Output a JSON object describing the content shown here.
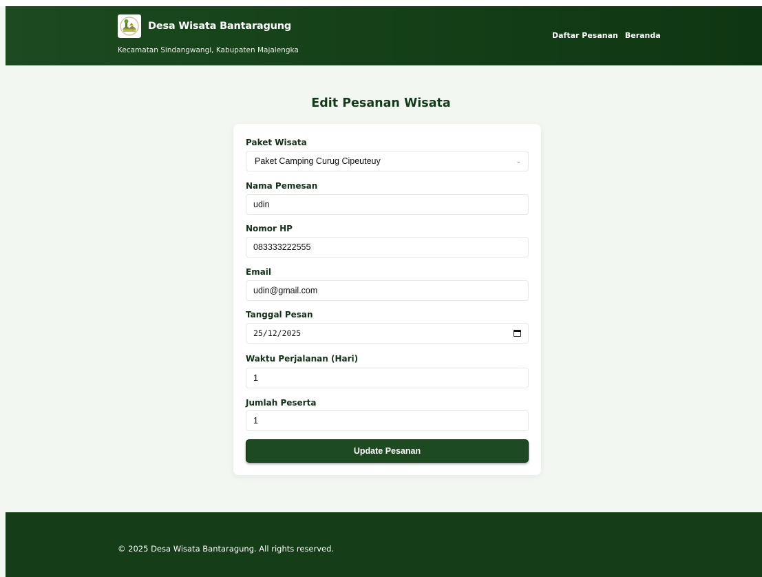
{
  "header": {
    "title": "Desa Wisata Bantaragung",
    "subtitle": "Kecamatan Sindangwangi, Kabupaten Majalengka",
    "logo_icon": "village-logo-icon",
    "nav": [
      {
        "label": "Daftar Pesanan"
      },
      {
        "label": "Beranda"
      }
    ]
  },
  "page": {
    "title": "Edit Pesanan Wisata"
  },
  "form": {
    "paket": {
      "label": "Paket Wisata",
      "value": "Paket Camping Curug Cipeuteuy"
    },
    "nama": {
      "label": "Nama Pemesan",
      "value": "udin"
    },
    "hp": {
      "label": "Nomor HP",
      "value": "083333222555"
    },
    "email": {
      "label": "Email",
      "value": "udin@gmail.com"
    },
    "tanggal": {
      "label": "Tanggal Pesan",
      "value": "25/12/2025"
    },
    "waktu": {
      "label": "Waktu Perjalanan (Hari)",
      "value": "1"
    },
    "peserta": {
      "label": "Jumlah Peserta",
      "value": "1"
    },
    "submit_label": "Update Pesanan"
  },
  "footer": {
    "copyright": "© 2025 Desa Wisata Bantaragung. All rights reserved."
  },
  "colors": {
    "header_bg": "#143f17",
    "accent": "#1d4a21",
    "page_bg": "#f3f7f2"
  }
}
